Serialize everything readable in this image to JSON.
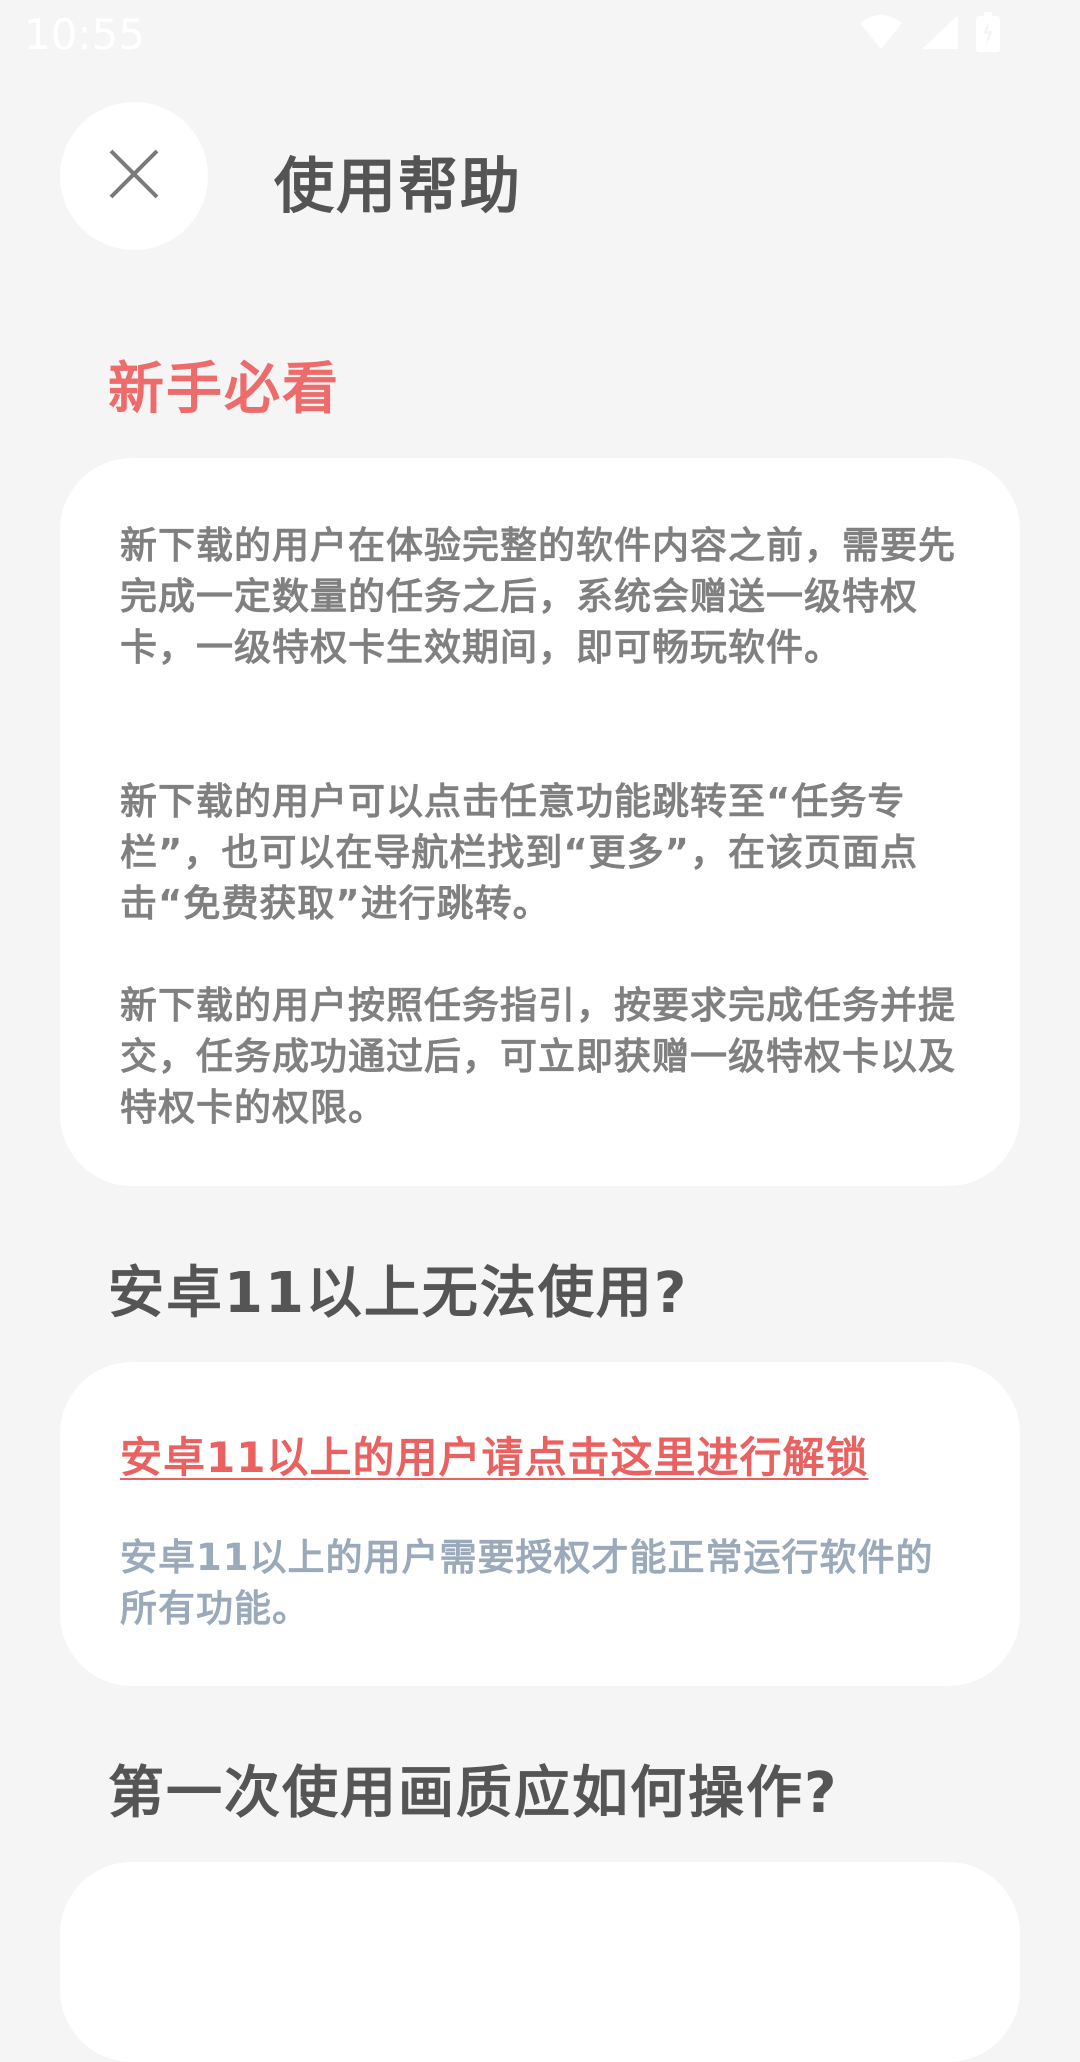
{
  "status_bar": {
    "time": "10:55",
    "icons": [
      "wifi-icon",
      "signal-icon",
      "battery-icon"
    ]
  },
  "header": {
    "title": "使用帮助",
    "close_icon": "close-icon"
  },
  "section1": {
    "title": "新手必看",
    "title_color": "#ee6b6b",
    "paragraphs": [
      "新下载的用户在体验完整的软件内容之前，需要先完成一定数量的任务之后，系统会赠送一级特权卡，一级特权卡生效期间，即可畅玩软件。",
      "新下载的用户可以点击任意功能跳转至“任务专栏”，也可以在导航栏找到“更多”，在该页面点击“免费获取”进行跳转。",
      "新下载的用户按照任务指引，按要求完成任务并提交，任务成功通过后，可立即获赠一级特权卡以及特权卡的权限。"
    ]
  },
  "section2": {
    "title": "安卓11以上无法使用?",
    "link_text": "安卓11以上的用户请点击这里进行解锁",
    "link_color": "#e96161",
    "note": "安卓11以上的用户需要授权才能正常运行软件的所有功能。",
    "note_color": "#9aaabb"
  },
  "section3": {
    "title": "第一次使用画质应如何操作?"
  }
}
